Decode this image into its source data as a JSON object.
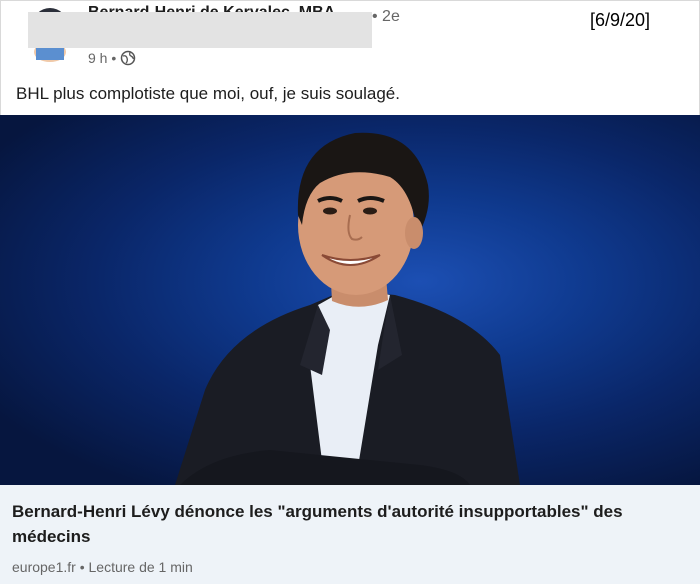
{
  "post": {
    "author_name": "Bernard-Henri de Kervalec, MBA",
    "connection_degree": "• 2e",
    "date_stamp": "[6/9/20]",
    "time_ago": "9 h •",
    "visibility_icon": "globe-icon",
    "text": "BHL plus complotiste que moi, ouf, je suis soulagé."
  },
  "media": {
    "description_icon": "portrait-photo"
  },
  "article_card": {
    "title": "Bernard-Henri Lévy dénonce les \"arguments d'autorité insupportables\" des médecins",
    "source": "europe1.fr • Lecture de 1 min"
  },
  "colors": {
    "background": "#ffffff",
    "card_background": "#eef3f8",
    "meta_text": "#666666",
    "photo_blue": "#0f3a8f"
  }
}
